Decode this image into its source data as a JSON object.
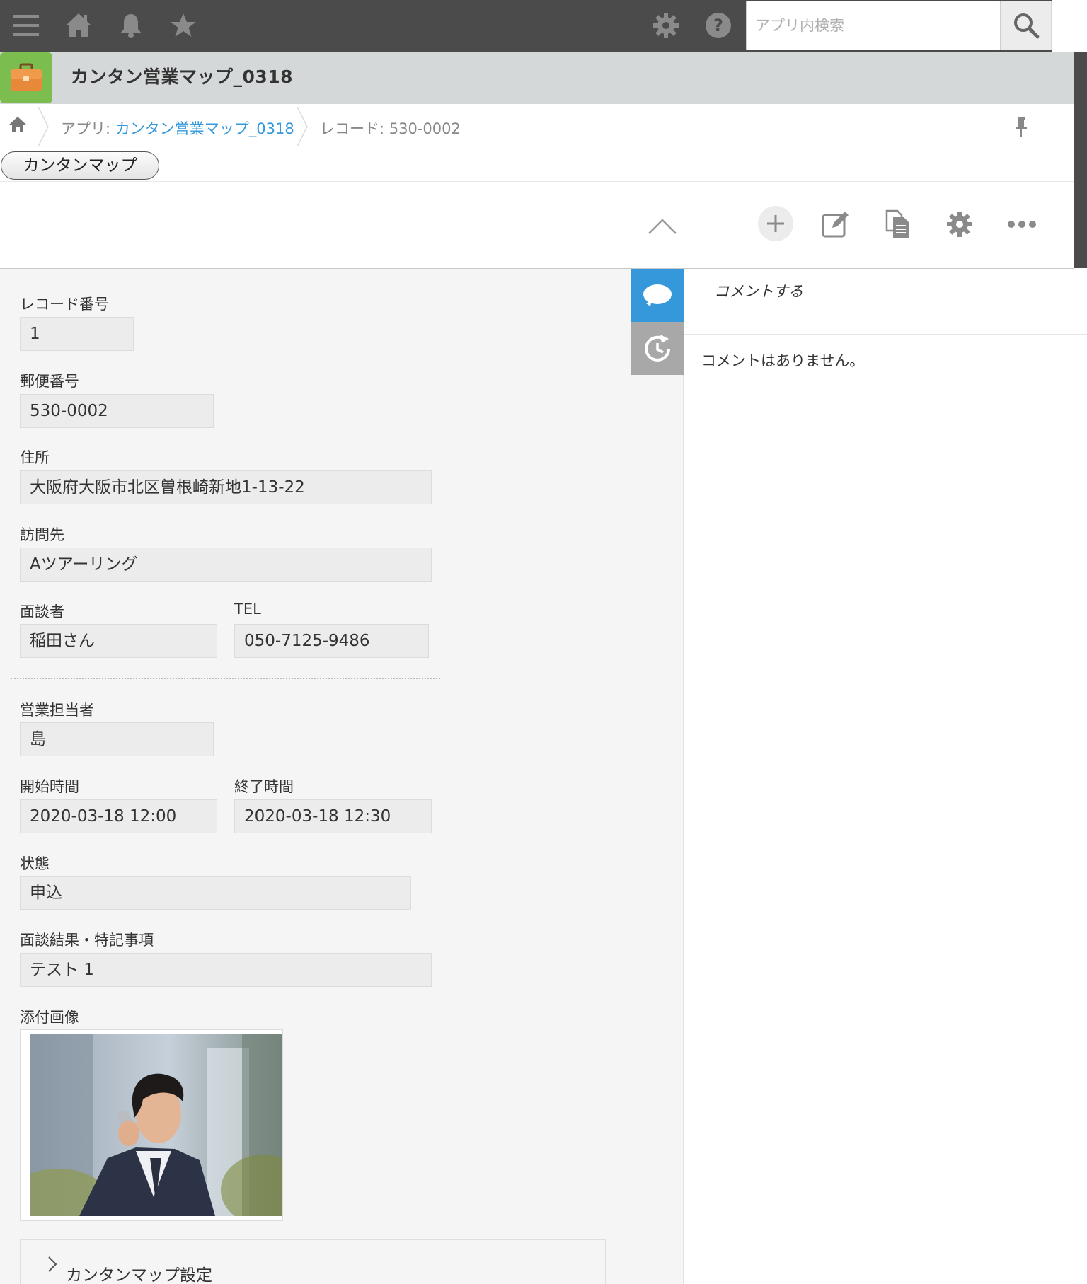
{
  "header": {
    "search_placeholder": "アプリ内検索"
  },
  "app": {
    "title": "カンタン営業マップ_0318"
  },
  "breadcrumb": {
    "app_prefix": "アプリ: ",
    "app_link": "カンタン営業マップ_0318",
    "record": "レコード: 530-0002"
  },
  "buttons": {
    "map": "カンタンマップ"
  },
  "fields": {
    "record_number": {
      "label": "レコード番号",
      "value": "1"
    },
    "postal_code": {
      "label": "郵便番号",
      "value": "530-0002"
    },
    "address": {
      "label": "住所",
      "value": "大阪府大阪市北区曽根崎新地1-13-22"
    },
    "visit_to": {
      "label": "訪問先",
      "value": "Aツアーリング"
    },
    "interviewee": {
      "label": "面談者",
      "value": "稲田さん"
    },
    "tel": {
      "label": "TEL",
      "value": "050-7125-9486"
    },
    "sales_rep": {
      "label": "営業担当者",
      "value": "島"
    },
    "start_time": {
      "label": "開始時間",
      "value": "2020-03-18 12:00"
    },
    "end_time": {
      "label": "終了時間",
      "value": "2020-03-18 12:30"
    },
    "status": {
      "label": "状態",
      "value": "申込"
    },
    "result_notes": {
      "label": "面談結果・特記事項",
      "value": "テスト 1"
    },
    "attachment": {
      "label": "添付画像"
    }
  },
  "group": {
    "label": "カンタンマップ設定"
  },
  "comments": {
    "write": "コメントする",
    "empty": "コメントはありません。"
  },
  "colors": {
    "topbar": "#4b4b4b",
    "app_header": "#d4d8d9",
    "app_logo": "#7cbd4f",
    "link": "#3498db",
    "comment_tab_active": "#3498db",
    "history_tab": "#a8a8a8"
  },
  "icons": {
    "topbar": [
      "menu-icon",
      "home-icon",
      "bell-icon",
      "star-icon",
      "gear-icon",
      "help-icon",
      "search-icon"
    ],
    "toolbar": [
      "chevron-up-icon",
      "plus-icon",
      "edit-icon",
      "copy-icon",
      "gear-icon",
      "more-icon"
    ],
    "side_tabs": [
      "comment-icon",
      "history-icon"
    ]
  }
}
